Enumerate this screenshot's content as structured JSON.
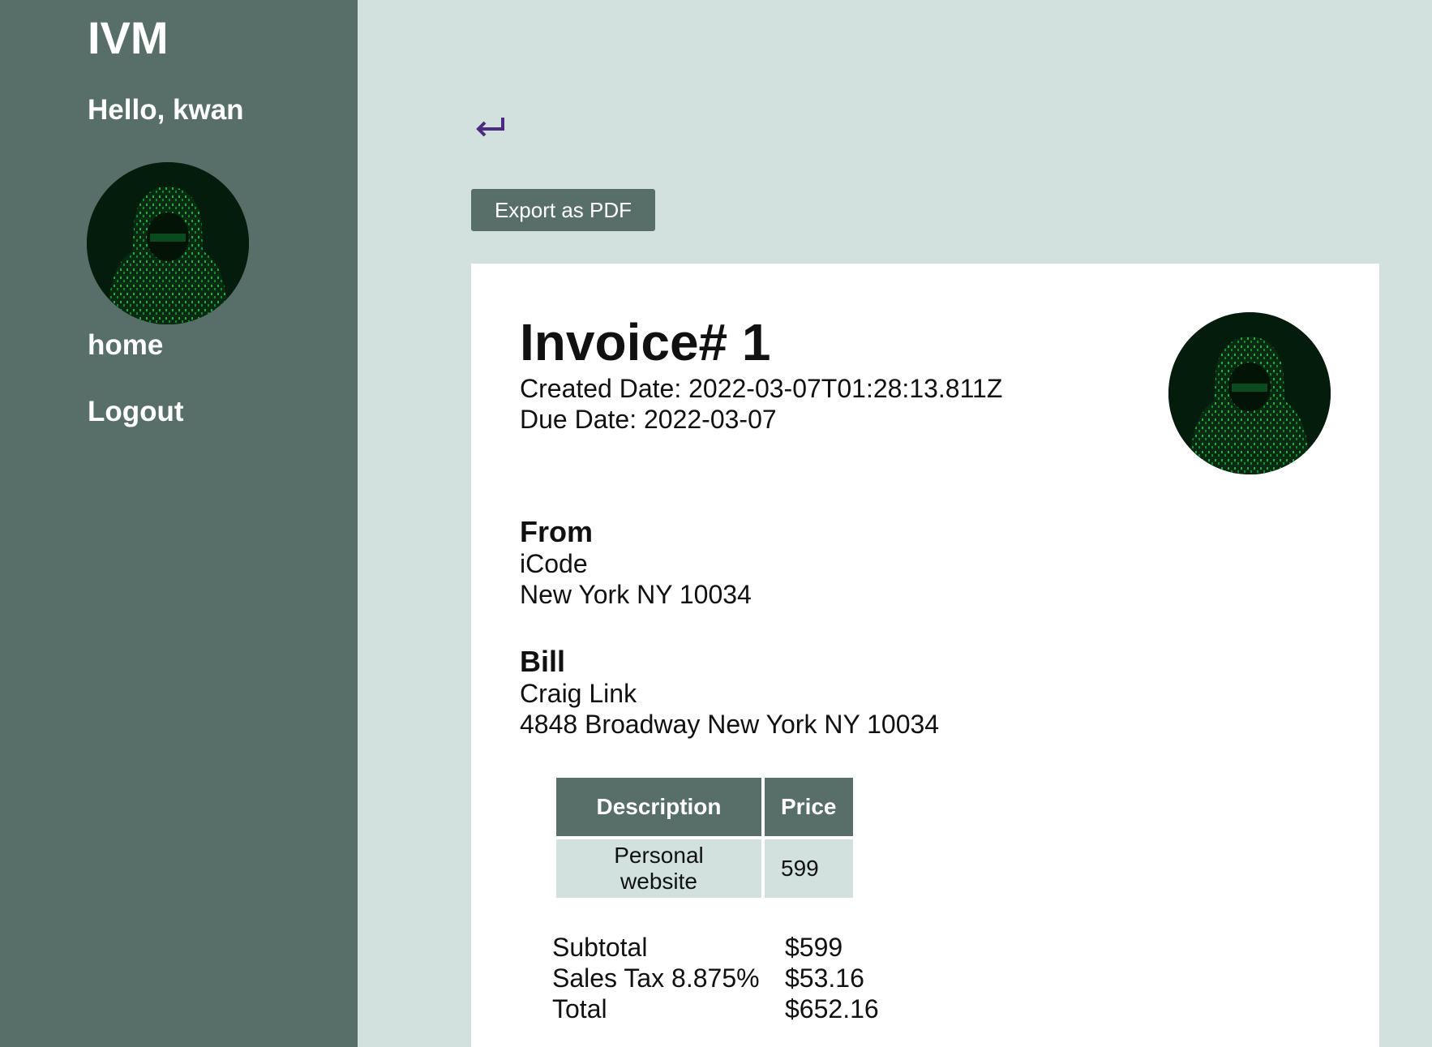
{
  "sidebar": {
    "brand": "IVM",
    "greeting": "Hello, kwan",
    "nav": [
      {
        "label": "home"
      },
      {
        "label": "Logout"
      }
    ]
  },
  "toolbar": {
    "back_icon": "return-arrow-icon",
    "export_label": "Export as PDF"
  },
  "invoice": {
    "title": "Invoice# 1",
    "created": "Created Date: 2022-03-07T01:28:13.811Z",
    "due": "Due Date: 2022-03-07",
    "from": {
      "heading": "From",
      "name": "iCode",
      "address": "New York NY 10034"
    },
    "bill": {
      "heading": "Bill",
      "name": "Craig Link",
      "address": "4848 Broadway New York NY 10034"
    },
    "table": {
      "headers": [
        "Description",
        "Price"
      ],
      "rows": [
        [
          "Personal website",
          "599"
        ]
      ]
    },
    "totals": [
      {
        "label": "Subtotal",
        "value": "$599"
      },
      {
        "label": "Sales Tax 8.875%",
        "value": "$53.16"
      },
      {
        "label": "Total",
        "value": "$652.16"
      }
    ]
  },
  "colors": {
    "sidebar_bg": "#576e69",
    "page_bg": "#d2e1de",
    "back_arrow": "#4b2a80"
  }
}
